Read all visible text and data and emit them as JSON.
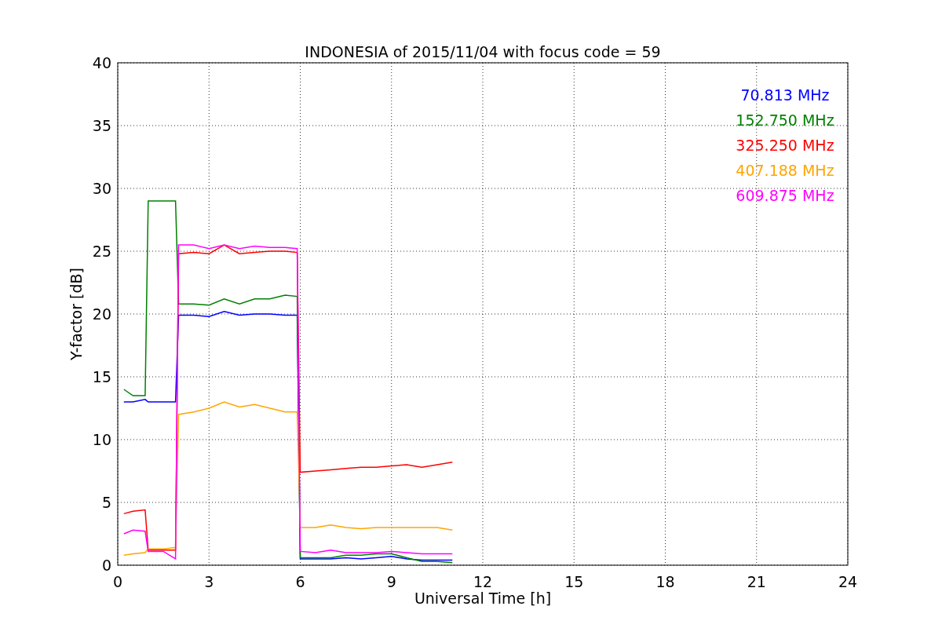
{
  "plot": {
    "chart_data": {
      "type": "line",
      "title": "INDONESIA of 2015/11/04 with focus code = 59",
      "xlabel": "Universal Time [h]",
      "ylabel": "Y-factor [dB]",
      "x": [
        0.2,
        0.5,
        0.9,
        1.0,
        1.5,
        1.9,
        2.0,
        2.5,
        3,
        3.5,
        4,
        4.5,
        5,
        5.5,
        5.9,
        6.0,
        6.5,
        7,
        7.5,
        8,
        8.5,
        9,
        9.5,
        10,
        10.5,
        11
      ],
      "series": [
        {
          "name": "70.813 MHz",
          "color": "#0000ff",
          "values": [
            13,
            13,
            13.2,
            13,
            13,
            13,
            19.9,
            19.9,
            19.8,
            20.2,
            19.9,
            20,
            20,
            19.9,
            19.9,
            0.5,
            0.5,
            0.5,
            0.6,
            0.5,
            0.6,
            0.7,
            0.5,
            0.4,
            0.4,
            0.4
          ]
        },
        {
          "name": "152.750 MHz",
          "color": "#008000",
          "values": [
            14,
            13.5,
            13.5,
            29,
            29,
            29,
            20.8,
            20.8,
            20.7,
            21.2,
            20.8,
            21.2,
            21.2,
            21.5,
            21.4,
            0.6,
            0.6,
            0.6,
            0.8,
            0.8,
            0.9,
            0.9,
            0.6,
            0.3,
            0.3,
            0.2
          ]
        },
        {
          "name": "325.250 MHz",
          "color": "#ff0000",
          "values": [
            4.1,
            4.3,
            4.4,
            1.2,
            1.2,
            1.2,
            24.8,
            24.9,
            24.8,
            25.5,
            24.8,
            24.9,
            25,
            25,
            24.9,
            7.4,
            7.5,
            7.6,
            7.7,
            7.8,
            7.8,
            7.9,
            8,
            7.8,
            8,
            8.2
          ]
        },
        {
          "name": "407.188 MHz",
          "color": "#ffa500",
          "values": [
            0.8,
            0.9,
            1.0,
            1.3,
            1.3,
            1.4,
            12,
            12.2,
            12.5,
            13,
            12.6,
            12.8,
            12.5,
            12.2,
            12.2,
            3,
            3,
            3.2,
            3,
            2.9,
            3,
            3,
            3,
            3,
            3,
            2.8
          ]
        },
        {
          "name": "609.875 MHz",
          "color": "#ff00ff",
          "values": [
            2.5,
            2.8,
            2.7,
            1.1,
            1.1,
            0.5,
            25.5,
            25.5,
            25.2,
            25.5,
            25.2,
            25.4,
            25.3,
            25.3,
            25.2,
            1.1,
            1,
            1.2,
            1,
            1,
            1,
            1.1,
            1,
            0.9,
            0.9,
            0.9
          ]
        }
      ],
      "grid": true,
      "xlim": [
        0,
        24
      ],
      "ylim": [
        0,
        40
      ],
      "xticks": [
        0,
        3,
        6,
        9,
        12,
        15,
        18,
        21,
        24
      ],
      "yticks": [
        0,
        5,
        10,
        15,
        20,
        25,
        30,
        35,
        40
      ]
    }
  }
}
